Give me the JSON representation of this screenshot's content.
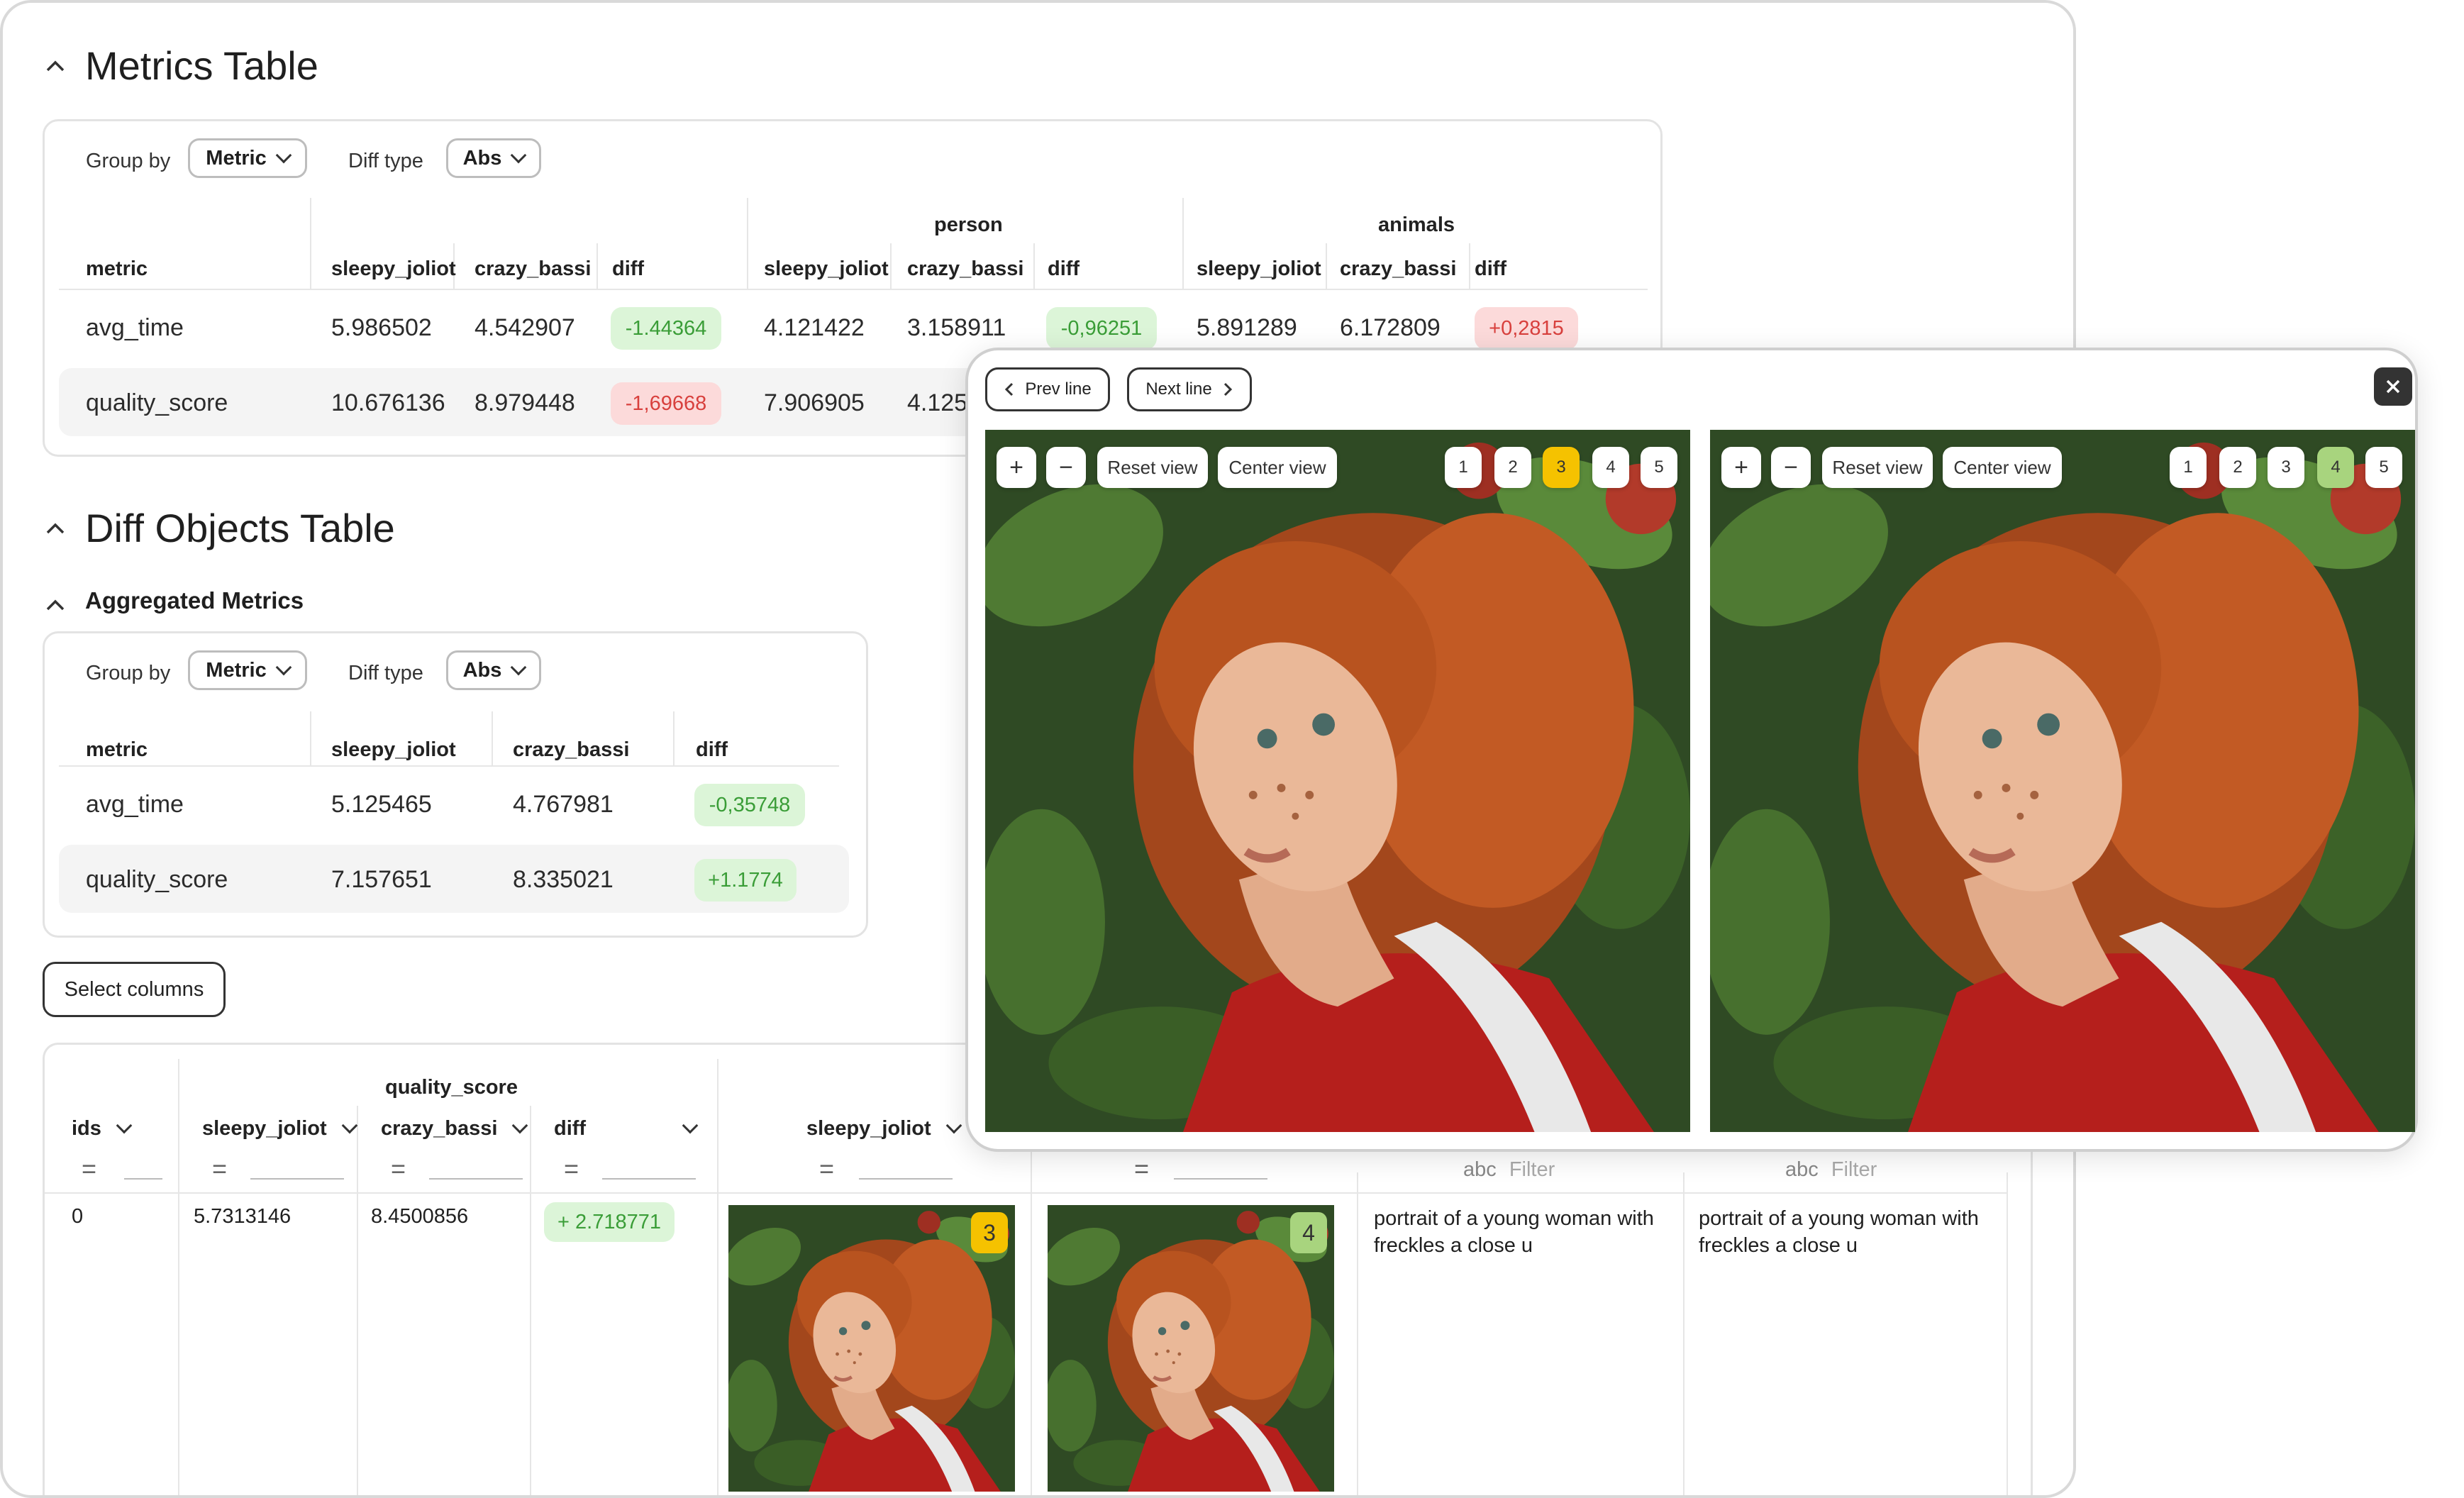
{
  "metrics_section": {
    "title": "Metrics Table",
    "group_by_label": "Group by",
    "group_by_value": "Metric",
    "diff_type_label": "Diff type",
    "diff_type_value": "Abs",
    "groups": [
      "person",
      "animals"
    ],
    "col_metric": "metric",
    "col_a": "sleepy_joliot",
    "col_b": "crazy_bassi",
    "col_diff": "diff",
    "rows": [
      {
        "metric": "avg_time",
        "a0": "5.986502",
        "b0": "4.542907",
        "d0": "-1.44364",
        "a1": "4.121422",
        "b1": "3.158911",
        "d1": "-0,96251",
        "a2": "5.891289",
        "b2": "6.172809",
        "d2": "+0,2815"
      },
      {
        "metric": "quality_score",
        "a0": "10.676136",
        "b0": "8.979448",
        "d0": "-1,69668",
        "a1": "7.906905",
        "b1": "4.125"
      }
    ]
  },
  "diff_section": {
    "title": "Diff Objects Table",
    "aggregated_title": "Aggregated Metrics",
    "group_by_label": "Group by",
    "group_by_value": "Metric",
    "diff_type_label": "Diff type",
    "diff_type_value": "Abs",
    "col_metric": "metric",
    "col_a": "sleepy_joliot",
    "col_b": "crazy_bassi",
    "col_diff": "diff",
    "rows": [
      {
        "metric": "avg_time",
        "a": "5.125465",
        "b": "4.767981",
        "d": "-0,35748"
      },
      {
        "metric": "quality_score",
        "a": "7.157651",
        "b": "8.335021",
        "d": "+1.1774"
      }
    ],
    "select_columns": "Select columns"
  },
  "objects_table": {
    "group_header": "quality_score",
    "col_ids": "ids",
    "col_a": "sleepy_joliot",
    "col_b": "crazy_bassi",
    "col_diff": "diff",
    "col_img_a": "sleepy_joliot",
    "filter_placeholder": "Filter",
    "filter_icon": "abc",
    "row": {
      "id": "0",
      "a": "5.7313146",
      "b": "8.4500856",
      "diff": "+ 2.718771",
      "badge_a": "3",
      "badge_b": "4",
      "caption_a": "portrait of a young woman with freckles a close u",
      "caption_b": "portrait of a young woman with freckles a close u"
    }
  },
  "viewer": {
    "prev_line": "Prev line",
    "next_line": "Next line",
    "zoom_in": "+",
    "zoom_out": "−",
    "reset_view": "Reset view",
    "center_view": "Center view",
    "pages": [
      "1",
      "2",
      "3",
      "4",
      "5"
    ],
    "left_selected": "3",
    "right_selected": "4",
    "close_icon": "close-icon"
  },
  "colors": {
    "good_bg": "#dcf5d8",
    "good_fg": "#3a9d37",
    "bad_bg": "#fcdada",
    "bad_fg": "#d8403d",
    "badge_yellow": "#f5c200",
    "badge_green": "#a8d47e"
  }
}
